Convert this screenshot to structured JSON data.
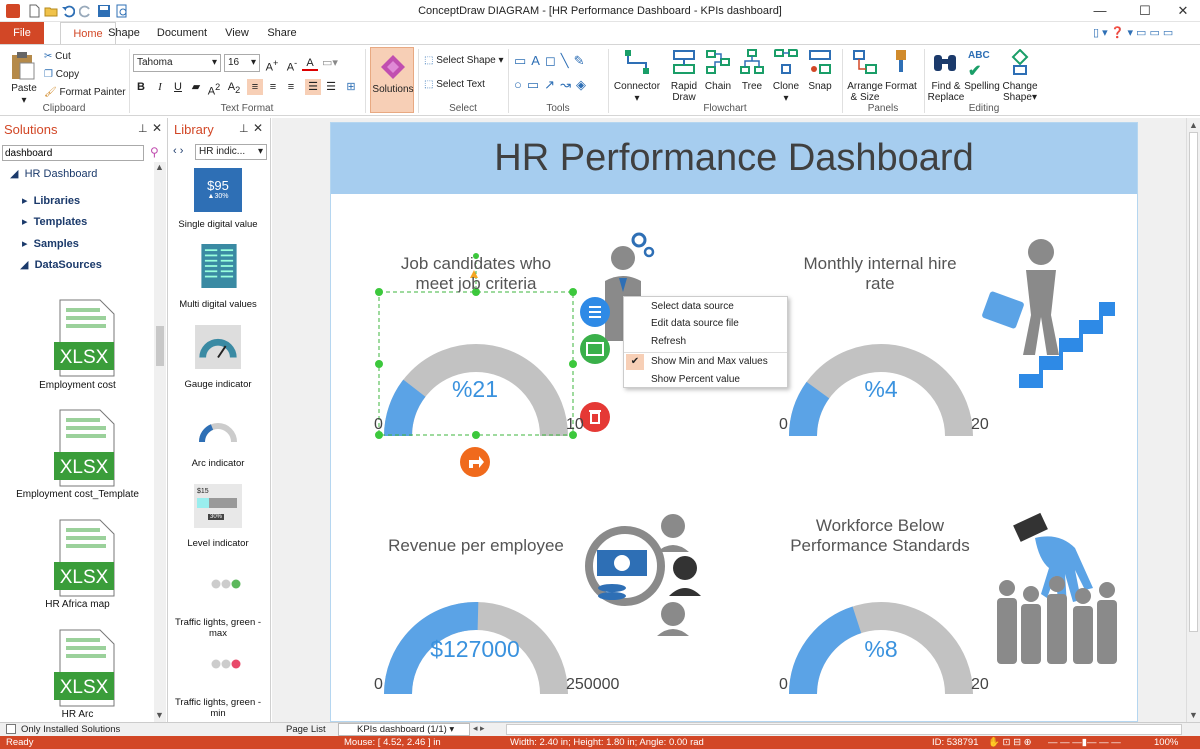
{
  "window": {
    "title": "ConceptDraw DIAGRAM - [HR Performance Dashboard - KPIs dashboard]"
  },
  "tabs": [
    "File",
    "Home",
    "Shape",
    "Document",
    "View",
    "Share"
  ],
  "ribbon": {
    "clipboard": {
      "group": "Clipboard",
      "paste": "Paste",
      "cut": "Cut",
      "copy": "Copy",
      "format_painter": "Format Painter"
    },
    "text_format": {
      "group": "Text Format",
      "font": "Tahoma",
      "size": "16"
    },
    "solutions": {
      "label": "Solutions"
    },
    "select": {
      "group": "Select",
      "select_shape": "Select Shape",
      "select_text": "Select Text"
    },
    "tools": {
      "group": "Tools"
    },
    "flowchart": {
      "group": "Flowchart",
      "connector": "Connector",
      "rapid_draw_1": "Rapid",
      "rapid_draw_2": "Draw",
      "chain": "Chain",
      "tree": "Tree",
      "clone": "Clone",
      "snap": "Snap"
    },
    "panels": {
      "group": "Panels",
      "arrange_1": "Arrange",
      "arrange_2": "& Size",
      "format": "Format"
    },
    "editing": {
      "group": "Editing",
      "find_1": "Find &",
      "find_2": "Replace",
      "spelling": "Spelling",
      "change_1": "Change",
      "change_2": "Shape"
    }
  },
  "solutions_panel": {
    "title": "Solutions",
    "search_value": "dashboard",
    "root": "HR Dashboard",
    "items": [
      "Libraries",
      "Templates",
      "Samples",
      "DataSources"
    ],
    "files": [
      {
        "badge": "XLSX",
        "label": "Employment cost"
      },
      {
        "badge": "XLSX",
        "label": "Employment cost_Template"
      },
      {
        "badge": "XLSX",
        "label": "HR Africa map"
      },
      {
        "badge": "XLSX",
        "label": "HR Arc"
      }
    ],
    "only_installed": "Only Installed Solutions"
  },
  "library_panel": {
    "title": "Library",
    "selector": "HR indic...",
    "items": [
      {
        "label": "Single digital value",
        "thumb_value": "$95",
        "thumb_delta": "▲30%"
      },
      {
        "label": "Multi digital values"
      },
      {
        "label": "Gauge indicator"
      },
      {
        "label": "Arc indicator"
      },
      {
        "label": "Level indicator",
        "thumb_value": "$15",
        "thumb_pct": "30%"
      },
      {
        "label": "Traffic lights, green - max"
      },
      {
        "label": "Traffic lights, green - min"
      }
    ]
  },
  "dashboard": {
    "title": "HR Performance Dashboard",
    "gauges": [
      {
        "title_1": "Job candidates who",
        "title_2": "meet job criteria",
        "value": "%21",
        "min": "0",
        "max": "10",
        "fraction": 0.21
      },
      {
        "title_1": "Monthly internal hire",
        "title_2": "rate",
        "value": "%4",
        "min": "0",
        "max": "20",
        "fraction": 0.2
      },
      {
        "title_1": "Revenue per employee",
        "title_2": "",
        "value": "$127000",
        "min": "0",
        "max": "250000",
        "fraction": 0.508
      },
      {
        "title_1": "Workforce Below",
        "title_2": "Performance Standards",
        "value": "%8",
        "min": "0",
        "max": "20",
        "fraction": 0.4
      }
    ],
    "colors": {
      "fill": "#5ba3e6",
      "track": "#c2c2c2",
      "header": "#a6cdef"
    }
  },
  "context_menu": {
    "items": [
      "Select data source",
      "Edit data source file",
      "Refresh",
      "Show Min and Max values",
      "Show Percent value"
    ],
    "checked": "Show Min and Max values"
  },
  "bottom": {
    "page_list": "Page List",
    "page_tab": "KPIs dashboard (1/1)"
  },
  "status": {
    "ready": "Ready",
    "mouse": "Mouse: [ 4.52, 2.46 ] in",
    "size": "Width: 2.40 in;  Height: 1.80 in;  Angle: 0.00 rad",
    "id": "ID: 538791",
    "zoom": "100%"
  }
}
